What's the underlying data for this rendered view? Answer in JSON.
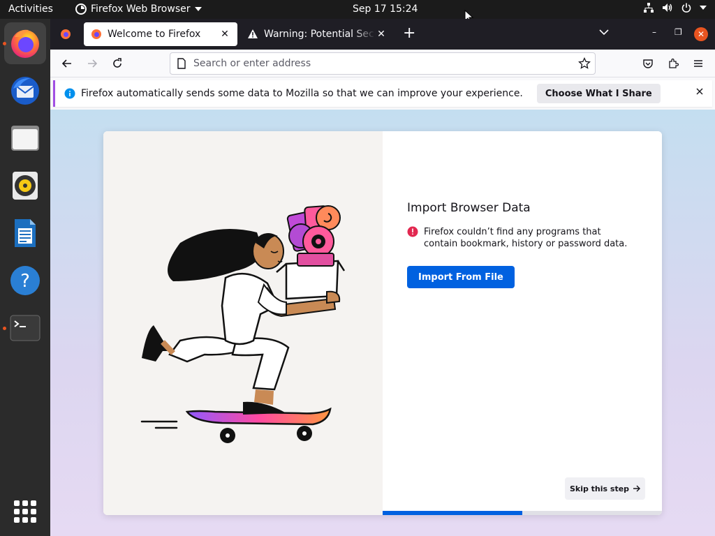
{
  "topbar": {
    "activities": "Activities",
    "app_name": "Firefox Web Browser",
    "clock": "Sep 17  15:24"
  },
  "dock": {
    "items": [
      {
        "name": "firefox",
        "running": true,
        "active": true
      },
      {
        "name": "thunderbird",
        "running": false,
        "active": false
      },
      {
        "name": "files",
        "running": false,
        "active": false
      },
      {
        "name": "rhythmbox",
        "running": false,
        "active": false
      },
      {
        "name": "libreoffice-writer",
        "running": false,
        "active": false
      },
      {
        "name": "help",
        "running": false,
        "active": false
      },
      {
        "name": "terminal",
        "running": true,
        "active": false
      }
    ]
  },
  "browser": {
    "tabs": [
      {
        "title": "Welcome to Firefox",
        "icon": "firefox-icon",
        "selected": true
      },
      {
        "title": "Warning: Potential Security Risk Ahead",
        "icon": "warning-icon",
        "selected": false
      }
    ],
    "urlbar": {
      "placeholder": "Search or enter address",
      "value": ""
    },
    "notification": {
      "text": "Firefox automatically sends some data to Mozilla so that we can improve your experience.",
      "button": "Choose What I Share"
    }
  },
  "onboarding": {
    "title": "Import Browser Data",
    "error_text": "Firefox couldn’t find any programs that contain bookmark, history or password data.",
    "import_button": "Import From File",
    "skip_button": "Skip this step",
    "progress": 0.5
  },
  "colors": {
    "accent": "#0061e0",
    "ubuntu_orange": "#e95420",
    "tabstrip": "#1f1e25",
    "notification_border": "#a14fe3"
  }
}
